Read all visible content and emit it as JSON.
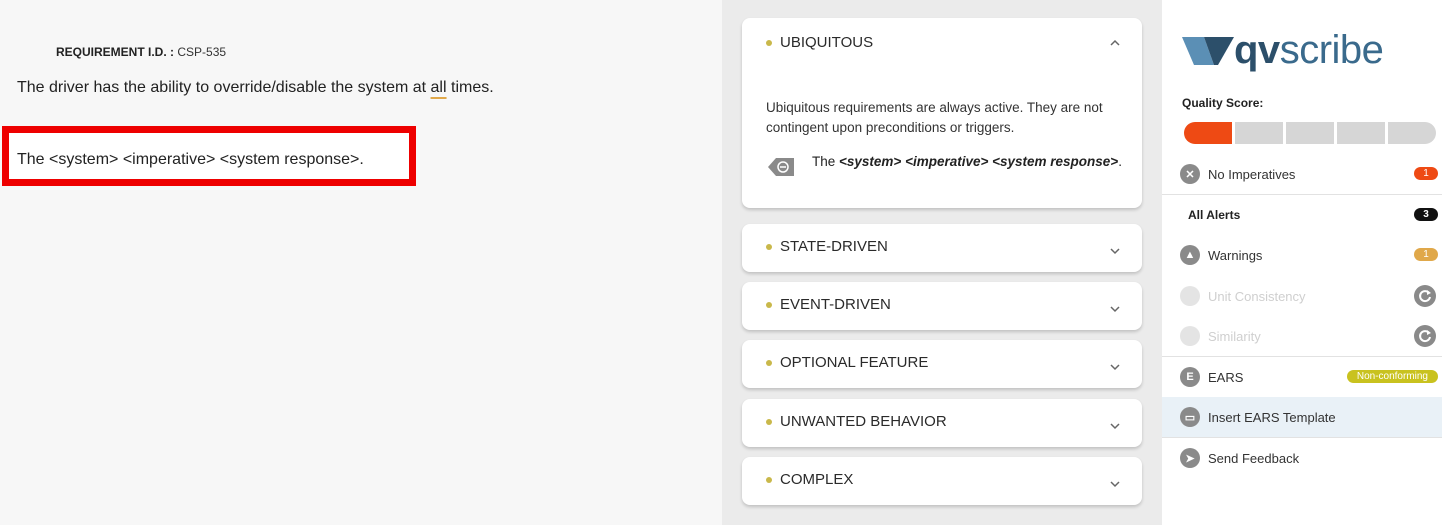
{
  "document": {
    "requirement_id_label": "REQUIREMENT I.D. :",
    "requirement_id": "CSP-535",
    "text_before": "The driver has the ability to override/disable the system at ",
    "text_flagged": "all",
    "text_after": " times.",
    "template_text": "The <system> <imperative> <system response>."
  },
  "ears_panel": {
    "expanded": {
      "title": "UBIQUITOUS",
      "description": "Ubiquitous requirements are always active. They are not contingent upon preconditions or triggers.",
      "template_prefix": "The ",
      "template_italic": "<system> <imperative> <system response>",
      "template_suffix": "."
    },
    "sections": [
      {
        "title": "STATE-DRIVEN"
      },
      {
        "title": "EVENT-DRIVEN"
      },
      {
        "title": "OPTIONAL FEATURE"
      },
      {
        "title": "UNWANTED BEHAVIOR"
      },
      {
        "title": "COMPLEX"
      }
    ]
  },
  "sidebar": {
    "logo_bold": "qv",
    "logo_light": "scribe",
    "quality_score_label": "Quality Score:",
    "quality_score": {
      "filled_segments": 1,
      "total_segments": 5
    },
    "items": {
      "no_imperatives": {
        "label": "No Imperatives",
        "count": "1",
        "color": "#ee4a14"
      },
      "all_alerts": {
        "label": "All Alerts",
        "count": "3",
        "color": "#111111"
      },
      "warnings": {
        "label": "Warnings",
        "count": "1",
        "color": "#e0a84a"
      },
      "unit_consistency": {
        "label": "Unit Consistency"
      },
      "similarity": {
        "label": "Similarity"
      },
      "ears": {
        "label": "EARS",
        "status": "Non-conforming",
        "color": "#c9c21f"
      },
      "insert_template": {
        "label": "Insert EARS Template"
      },
      "send_feedback": {
        "label": "Send Feedback"
      }
    }
  },
  "colors": {
    "highlight_box": "#ee0000",
    "accent_dot": "#c9b84a",
    "brand": "#3a6a8c"
  }
}
